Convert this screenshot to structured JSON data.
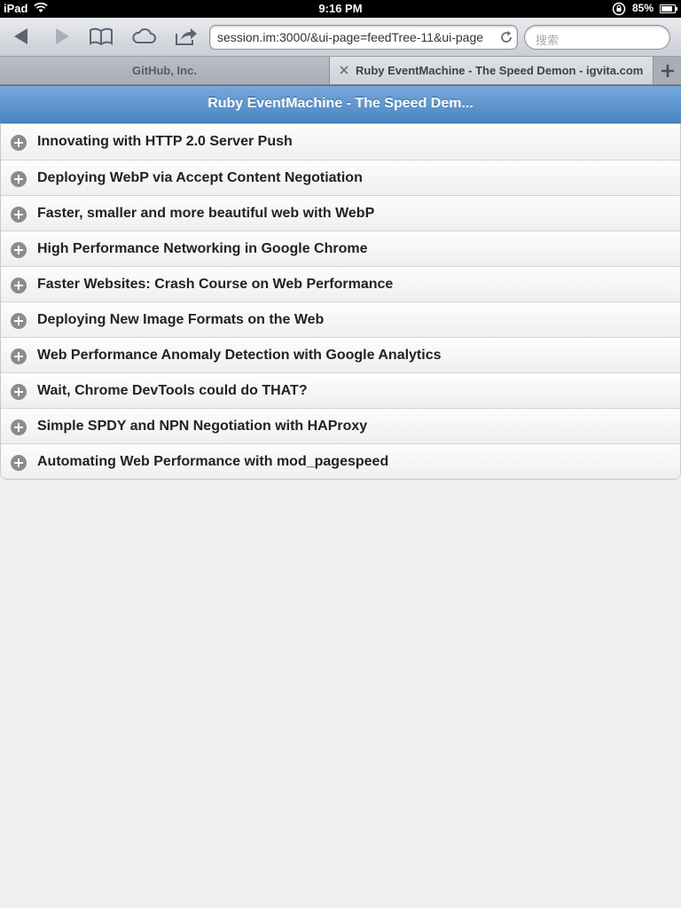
{
  "status_bar": {
    "carrier": "iPad",
    "time": "9:16 PM",
    "battery": "85%",
    "battery_level": 0.85
  },
  "toolbar": {
    "url": "session.im:3000/&ui-page=feedTree-11&ui-page",
    "search_placeholder": "搜索",
    "icons": [
      "back-icon",
      "forward-icon",
      "bookmarks-icon",
      "icloud-icon",
      "share-icon",
      "reload-icon"
    ]
  },
  "tabs": [
    {
      "label": "GitHub, Inc.",
      "active": false
    },
    {
      "label": "Ruby EventMachine - The Speed Demon - igvita.com",
      "active": true
    }
  ],
  "page": {
    "title": "Ruby EventMachine - The Speed Dem..."
  },
  "items": [
    {
      "label": "Innovating with HTTP 2.0 Server Push"
    },
    {
      "label": "Deploying WebP via Accept Content Negotiation"
    },
    {
      "label": "Faster, smaller and more beautiful web with WebP"
    },
    {
      "label": "High Performance Networking in Google Chrome"
    },
    {
      "label": "Faster Websites: Crash Course on Web Performance"
    },
    {
      "label": "Deploying New Image Formats on the Web"
    },
    {
      "label": "Web Performance Anomaly Detection with Google Analytics"
    },
    {
      "label": "Wait, Chrome DevTools could do THAT?"
    },
    {
      "label": "Simple SPDY and NPN Negotiation with HAProxy"
    },
    {
      "label": "Automating Web Performance with mod_pagespeed"
    }
  ],
  "colors": {
    "header_blue": "#4a86c3",
    "status_bar": "#000000"
  }
}
